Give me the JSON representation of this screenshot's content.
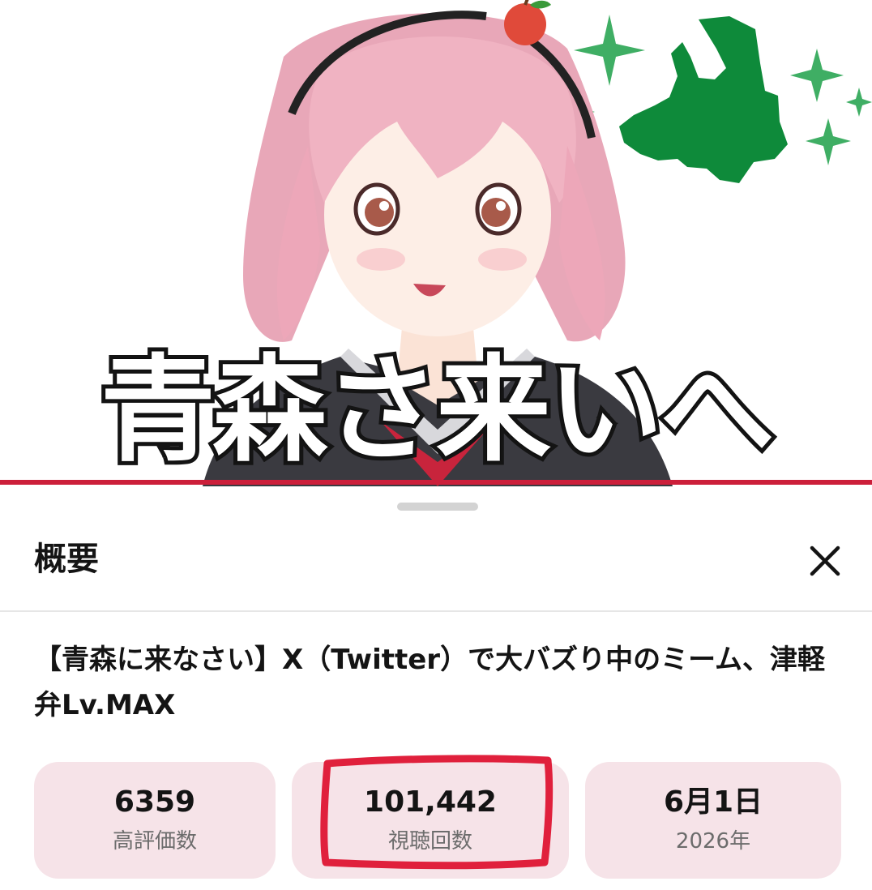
{
  "thumbnail": {
    "caption": "青森さ来いへ",
    "progress": 1.0
  },
  "sheet": {
    "title": "概要",
    "close_icon": "close-icon"
  },
  "video": {
    "title": "【青森に来なさい】X（Twitter）で大バズり中のミーム、津軽弁Lv.MAX"
  },
  "stats": [
    {
      "value": "6359",
      "label": "高評価数"
    },
    {
      "value": "101,442",
      "label": "視聴回数"
    },
    {
      "value": "6月1日",
      "label": "2026年"
    }
  ],
  "colors": {
    "accent": "#cc1f3a",
    "card": "#f6e3e8",
    "annotation": "#e0203c",
    "map": "#0e8a3a"
  }
}
